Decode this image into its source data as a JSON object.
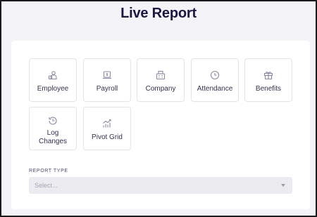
{
  "page": {
    "title": "Live Report"
  },
  "tiles": [
    {
      "label": "Employee",
      "icon": "employee-icon"
    },
    {
      "label": "Payroll",
      "icon": "payroll-icon"
    },
    {
      "label": "Company",
      "icon": "company-icon"
    },
    {
      "label": "Attendance",
      "icon": "clock-icon"
    },
    {
      "label": "Benefits",
      "icon": "gift-icon"
    },
    {
      "label": "Log Changes",
      "icon": "history-icon"
    },
    {
      "label": "Pivot Grid",
      "icon": "chart-icon"
    }
  ],
  "report_type": {
    "label": "REPORT TYPE",
    "placeholder": "Select..."
  }
}
